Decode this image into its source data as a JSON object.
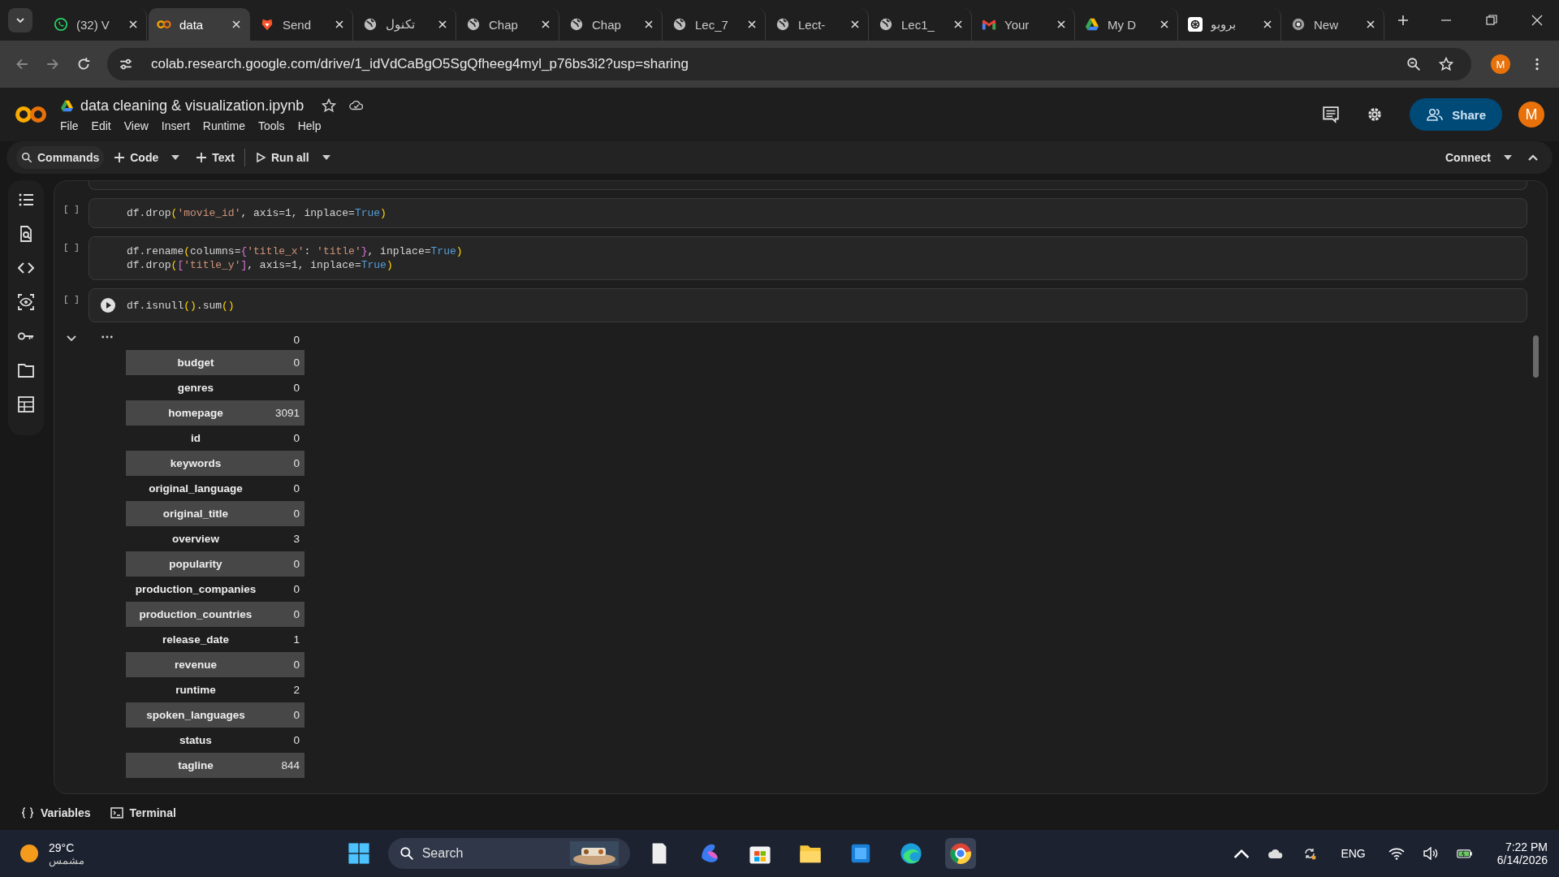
{
  "browser": {
    "tabs": [
      {
        "kind": "whatsapp",
        "title": "(32) V",
        "selected": false
      },
      {
        "kind": "colab",
        "title": "data",
        "selected": true
      },
      {
        "kind": "lion",
        "title": "Send",
        "selected": false
      },
      {
        "kind": "globe",
        "title": "تكنول",
        "selected": false
      },
      {
        "kind": "globe",
        "title": "Chap",
        "selected": false
      },
      {
        "kind": "globe",
        "title": "Chap",
        "selected": false
      },
      {
        "kind": "globe",
        "title": "Lec_7",
        "selected": false
      },
      {
        "kind": "globe",
        "title": "Lect-",
        "selected": false
      },
      {
        "kind": "globe",
        "title": "Lec1_",
        "selected": false
      },
      {
        "kind": "gmail",
        "title": "Your",
        "selected": false
      },
      {
        "kind": "drive",
        "title": "My D",
        "selected": false
      },
      {
        "kind": "openai",
        "title": "بروبو",
        "selected": false
      },
      {
        "kind": "chrome",
        "title": "New",
        "selected": false
      }
    ],
    "url": "colab.research.google.com/drive/1_idVdCaBgO5SgQfheeg4myl_p76bs3i2?usp=sharing",
    "profile": "M"
  },
  "notebook": {
    "title": "data cleaning & visualization.ipynb",
    "menu": [
      "File",
      "Edit",
      "View",
      "Insert",
      "Runtime",
      "Tools",
      "Help"
    ],
    "share": "Share",
    "avatar": "M",
    "toolbar": {
      "commands": "Commands",
      "code": "Code",
      "text": "Text",
      "run_all": "Run all",
      "connect": "Connect"
    }
  },
  "cells": [
    {
      "exec_mark": "[ ]",
      "lines": [
        [
          {
            "text": "df.drop",
            "kind": "t"
          },
          {
            "text": "(",
            "kind": "p"
          },
          {
            "text": "'movie_id'",
            "kind": "s"
          },
          {
            "text": ", axis=1, inplace=",
            "kind": "t"
          },
          {
            "text": "True",
            "kind": "k"
          },
          {
            "text": ")",
            "kind": "p"
          }
        ]
      ]
    },
    {
      "exec_mark": "[ ]",
      "lines": [
        [
          {
            "text": "df.rename",
            "kind": "t"
          },
          {
            "text": "(",
            "kind": "p"
          },
          {
            "text": "columns=",
            "kind": "t"
          },
          {
            "text": "{",
            "kind": "b"
          },
          {
            "text": "'title_x'",
            "kind": "s"
          },
          {
            "text": ": ",
            "kind": "t"
          },
          {
            "text": "'title'",
            "kind": "s"
          },
          {
            "text": "}",
            "kind": "b"
          },
          {
            "text": ", inplace=",
            "kind": "t"
          },
          {
            "text": "True",
            "kind": "k"
          },
          {
            "text": ")",
            "kind": "p"
          }
        ],
        [
          {
            "text": "df.drop",
            "kind": "t"
          },
          {
            "text": "(",
            "kind": "p"
          },
          {
            "text": "[",
            "kind": "b"
          },
          {
            "text": "'title_y'",
            "kind": "s"
          },
          {
            "text": "]",
            "kind": "b"
          },
          {
            "text": ", axis=1, inplace=",
            "kind": "t"
          },
          {
            "text": "True",
            "kind": "k"
          },
          {
            "text": ")",
            "kind": "p"
          }
        ]
      ]
    },
    {
      "exec_mark": "[ ]",
      "run_button": true,
      "lines": [
        [
          {
            "text": "df.isnull",
            "kind": "t"
          },
          {
            "text": "()",
            "kind": "p"
          },
          {
            "text": ".sum",
            "kind": "t"
          },
          {
            "text": "()",
            "kind": "p"
          }
        ]
      ],
      "output": {
        "header": "0",
        "rows": [
          {
            "label": "budget",
            "value": "0"
          },
          {
            "label": "genres",
            "value": "0"
          },
          {
            "label": "homepage",
            "value": "3091"
          },
          {
            "label": "id",
            "value": "0"
          },
          {
            "label": "keywords",
            "value": "0"
          },
          {
            "label": "original_language",
            "value": "0"
          },
          {
            "label": "original_title",
            "value": "0"
          },
          {
            "label": "overview",
            "value": "3"
          },
          {
            "label": "popularity",
            "value": "0"
          },
          {
            "label": "production_companies",
            "value": "0"
          },
          {
            "label": "production_countries",
            "value": "0"
          },
          {
            "label": "release_date",
            "value": "1"
          },
          {
            "label": "revenue",
            "value": "0"
          },
          {
            "label": "runtime",
            "value": "2"
          },
          {
            "label": "spoken_languages",
            "value": "0"
          },
          {
            "label": "status",
            "value": "0"
          },
          {
            "label": "tagline",
            "value": "844"
          }
        ]
      }
    }
  ],
  "bottom_bar": [
    "Variables",
    "Terminal"
  ],
  "taskbar": {
    "temperature": "29°C",
    "condition": "مشمس",
    "search": "Search",
    "language": "ENG",
    "time": "7:22 PM",
    "date": "6/14/2026"
  }
}
